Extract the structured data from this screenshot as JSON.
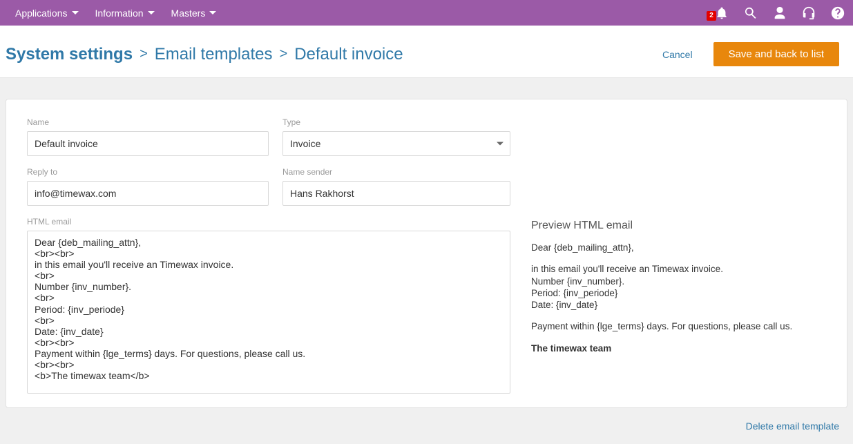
{
  "nav": {
    "items": [
      "Applications",
      "Information",
      "Masters"
    ],
    "notification_badge": "2"
  },
  "header": {
    "breadcrumb_root": "System settings",
    "breadcrumb_mid": "Email templates",
    "breadcrumb_leaf": "Default invoice",
    "cancel": "Cancel",
    "save": "Save and back to list"
  },
  "form": {
    "name_label": "Name",
    "name_value": "Default invoice",
    "type_label": "Type",
    "type_value": "Invoice",
    "reply_to_label": "Reply to",
    "reply_to_value": "info@timewax.com",
    "sender_label": "Name sender",
    "sender_value": "Hans Rakhorst",
    "html_label": "HTML email",
    "html_value": "Dear {deb_mailing_attn},\n<br><br>\nin this email you'll receive an Timewax invoice.\n<br>\nNumber {inv_number}.\n<br>\nPeriod: {inv_periode}\n<br>\nDate: {inv_date}\n<br><br>\nPayment within {lge_terms} days. For questions, please call us.\n<br><br>\n<b>The timewax team</b>"
  },
  "preview": {
    "title": "Preview HTML email",
    "line1": "Dear {deb_mailing_attn},",
    "line2": "in this email you'll receive an Timewax invoice.",
    "line3": "Number {inv_number}.",
    "line4": "Period: {inv_periode}",
    "line5": "Date: {inv_date}",
    "line6": "Payment within {lge_terms} days. For questions, please call us.",
    "line7": "The timewax team"
  },
  "footer": {
    "delete": "Delete email template"
  }
}
